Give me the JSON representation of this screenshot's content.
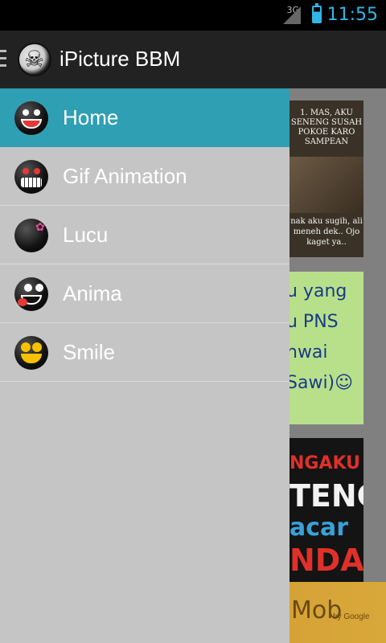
{
  "status_bar": {
    "network": "3G",
    "time": "11:55"
  },
  "action_bar": {
    "title": "iPicture BBM"
  },
  "drawer": {
    "items": [
      {
        "label": "Home",
        "icon": "angry-emoji-icon",
        "active": true
      },
      {
        "label": "Gif Animation",
        "icon": "devil-emoji-icon",
        "active": false
      },
      {
        "label": "Lucu",
        "icon": "bomb-emoji-icon",
        "active": false
      },
      {
        "label": "Anima",
        "icon": "tongue-emoji-icon",
        "active": false
      },
      {
        "label": "Smile",
        "icon": "money-emoji-icon",
        "active": false
      }
    ]
  },
  "background_cards": {
    "card1": {
      "top_text": "1. MAS, AKU SENENG SUSAH POKOE KARO SAMPEAN",
      "bottom_text": "nak aku sugih, ali meneh dek.. Ojo kaget ya.."
    },
    "card2": {
      "text_lines": [
        "u yang",
        "u PNS",
        "nwai",
        "Sawi)☺"
      ]
    },
    "card3": {
      "text_lines": [
        "NGAKU",
        "TENG",
        "acar",
        "NDA"
      ]
    }
  },
  "ad": {
    "text": "Mob",
    "sub": "by Google"
  },
  "colors": {
    "accent": "#2f9fb3",
    "drawer_bg": "#c5c5c5",
    "action_bar": "#222222",
    "status_time": "#33b5e5"
  }
}
